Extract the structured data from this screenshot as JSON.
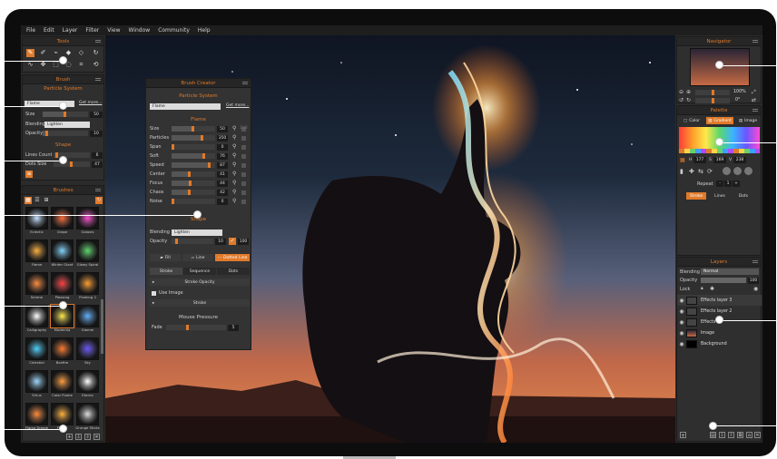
{
  "menu": [
    "File",
    "Edit",
    "Layer",
    "Filter",
    "View",
    "Window",
    "Community",
    "Help"
  ],
  "tools": {
    "title": "Tools"
  },
  "brush": {
    "title": "Brush",
    "subtitle": "Particle System",
    "preset": "Flame",
    "get_more": "Get more...",
    "size_label": "Size",
    "size_value": "50",
    "size_level": 0.5,
    "blending_label": "Blending",
    "blending_value": "Lighten",
    "opacity_label": "Opacity",
    "opacity_value": "10",
    "opacity_level": 0.1,
    "shape_title": "Shape",
    "lines_count_label": "Lines Count",
    "lines_count_value": "6",
    "dots_size_label": "Dots Size",
    "dots_size_value": "47"
  },
  "brushes": {
    "title": "Brushes",
    "items": [
      "Eclectic",
      "Grape",
      "Galaxis",
      "Flame",
      "Winter Giant",
      "Glowy Spiral",
      "Serene",
      "Pleasing",
      "Flaming 2",
      "Calligraphy",
      "Modernia",
      "Glamm",
      "Celestial",
      "Bonfire",
      "Sky",
      "Sirius",
      "Color Flame",
      "Eterna",
      "Flame Dream",
      "Flame",
      "Grunge Sticks"
    ]
  },
  "creator": {
    "title": "Brush Creator",
    "subtitle": "Particle System",
    "preset": "Flame",
    "get_more": "Get more...",
    "flame_title": "Flame",
    "params": [
      {
        "label": "Size",
        "value": "50",
        "level": 0.5
      },
      {
        "label": "Particles",
        "value": "350",
        "level": 0.7
      },
      {
        "label": "Span",
        "value": "0",
        "level": 0.0
      },
      {
        "label": "Soft",
        "value": "76",
        "level": 0.76
      },
      {
        "label": "Speed",
        "value": "87",
        "level": 0.87
      },
      {
        "label": "Center",
        "value": "41",
        "level": 0.41
      },
      {
        "label": "Focus",
        "value": "44",
        "level": 0.44
      },
      {
        "label": "Chaos",
        "value": "42",
        "level": 0.42
      },
      {
        "label": "Noise",
        "value": "0",
        "level": 0.0
      }
    ],
    "extra_value": "100",
    "shape_title": "Shape",
    "blending_label": "Blending",
    "blending_value": "Lighten",
    "opacity_label": "Opacity",
    "opacity_value": "10",
    "opacity_value2": "100",
    "fill_label": "Fill",
    "line_label": "Line",
    "dotted_label": "Dotted Line",
    "tabs": [
      "Stroke",
      "Sequence",
      "Dots"
    ],
    "stroke_opacity": "Stroke Opacity",
    "use_image": "Use Image",
    "stroke": "Stroke",
    "pressure_title": "Mouse Pressure",
    "fade_label": "Fade",
    "fade_value": "5"
  },
  "navigator": {
    "title": "Navigator",
    "zoom": "100%",
    "angle": "0°"
  },
  "palette": {
    "title": "Palette",
    "tabs": [
      "Color",
      "Gradient",
      "Image"
    ],
    "h": "177",
    "s": "169",
    "v": "238",
    "repeat_label": "Repeat",
    "repeat_value": "1",
    "modes": [
      "Stroke",
      "Lines",
      "Dots"
    ]
  },
  "layers": {
    "title": "Layers",
    "blending_label": "Blending",
    "blending_value": "Normal",
    "opacity_label": "Opacity",
    "opacity_value": "100",
    "lock_label": "Lock",
    "items": [
      "Effects layer 3",
      "Effects layer 2",
      "Effects",
      "Image",
      "Background"
    ]
  },
  "colors": {
    "accent": "#e07a2a",
    "panel": "#2f2f2f",
    "bg": "#2b2b2b"
  }
}
